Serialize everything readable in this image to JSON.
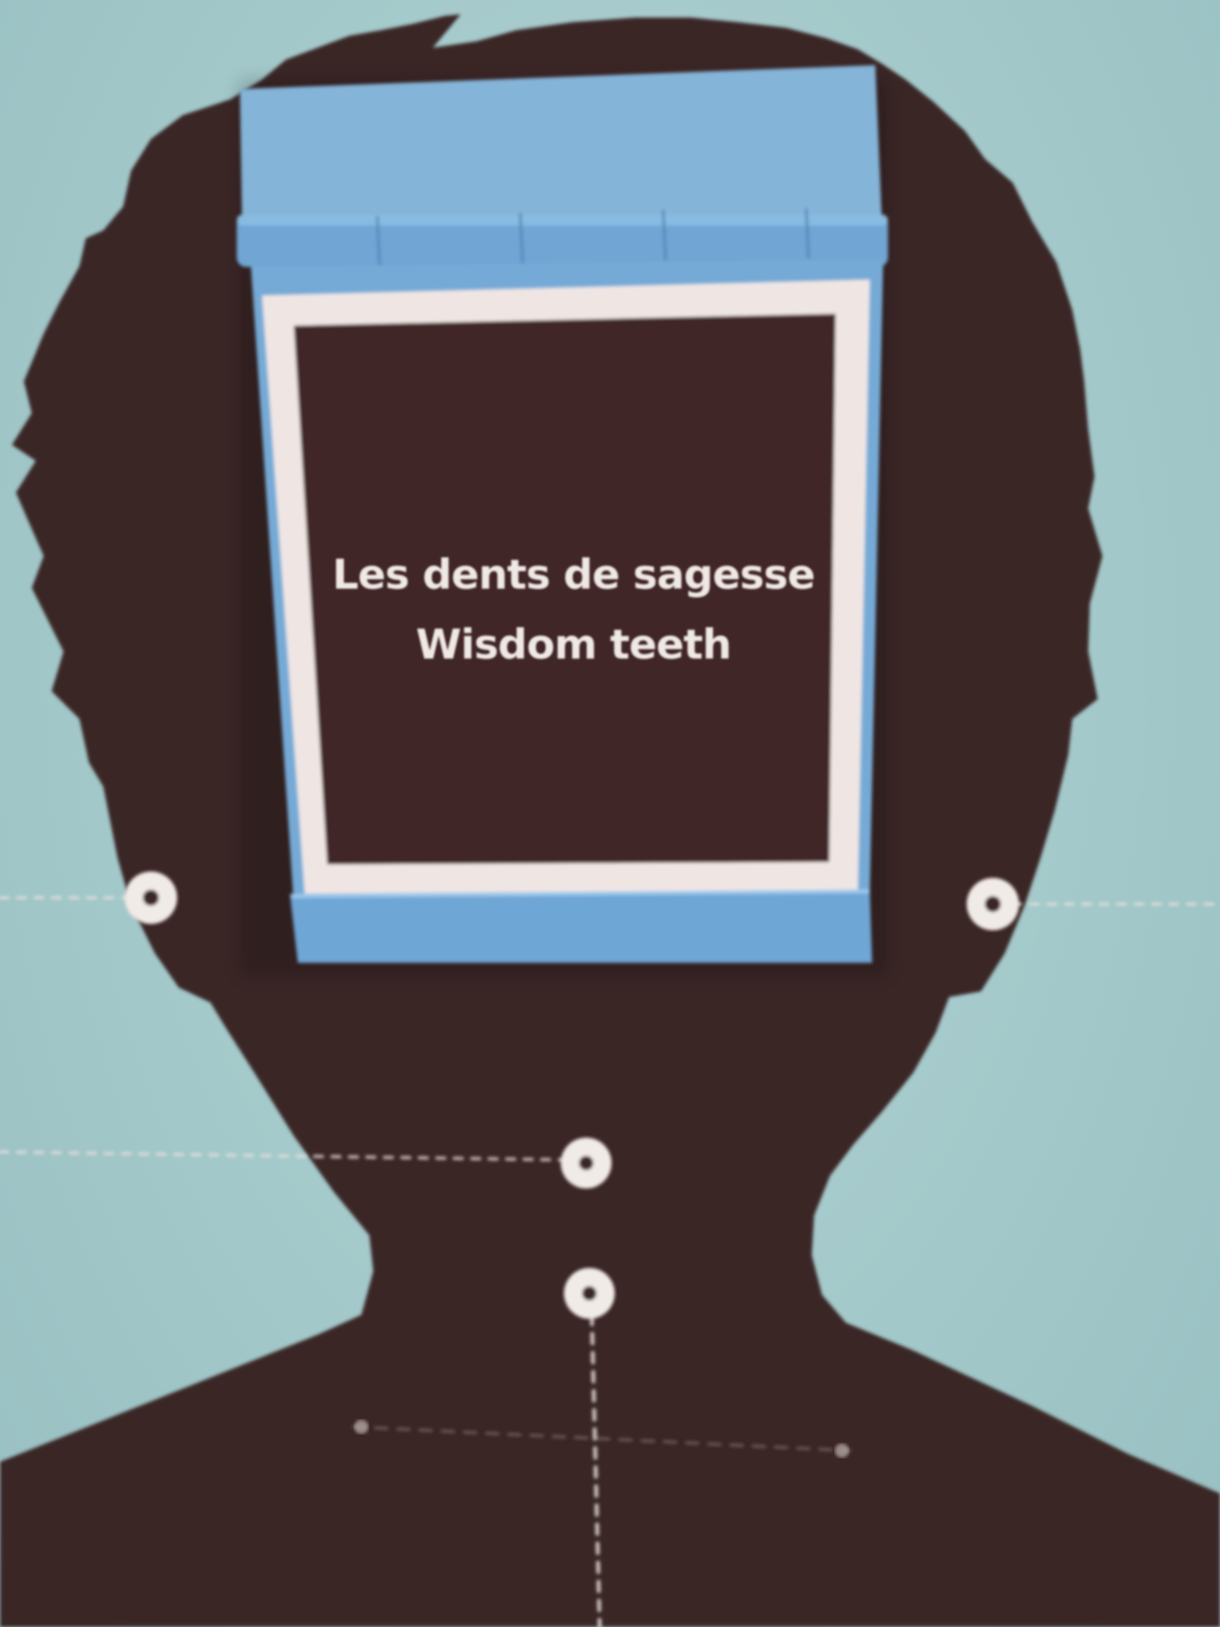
{
  "exhibit": {
    "flap_text_fr": "Les dents de sagesse",
    "flap_text_en": "Wisdom teeth",
    "colors": {
      "background": "#a9cccd",
      "silhouette": "#3a2827",
      "flap_blue": "#7fb0d9",
      "flap_border": "#efe6e4",
      "marker_white": "#f1ebe8",
      "text": "#efe9e6"
    }
  }
}
